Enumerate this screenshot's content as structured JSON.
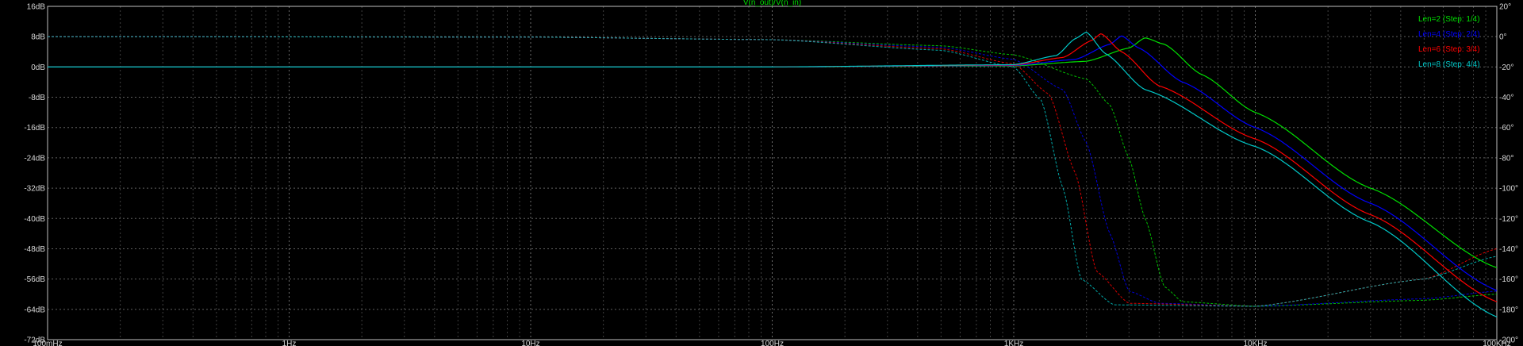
{
  "chart_data": {
    "type": "line",
    "title": "V(n_out)/V(n_in)",
    "x_scale": "log",
    "xlim": [
      0.1,
      100000
    ],
    "ylim_left": [
      -72,
      16
    ],
    "ylim_right": [
      -200,
      20
    ],
    "x_ticks": [
      {
        "value": 0.1,
        "label": "100mHz"
      },
      {
        "value": 1,
        "label": "1Hz"
      },
      {
        "value": 10,
        "label": "10Hz"
      },
      {
        "value": 100,
        "label": "100Hz"
      },
      {
        "value": 1000,
        "label": "1KHz"
      },
      {
        "value": 10000,
        "label": "10KHz"
      },
      {
        "value": 100000,
        "label": "100KHz"
      }
    ],
    "y_left_ticks": [
      {
        "value": 16,
        "label": "16dB"
      },
      {
        "value": 8,
        "label": "8dB"
      },
      {
        "value": 0,
        "label": "0dB"
      },
      {
        "value": -8,
        "label": "-8dB"
      },
      {
        "value": -16,
        "label": "-16dB"
      },
      {
        "value": -24,
        "label": "-24dB"
      },
      {
        "value": -32,
        "label": "-32dB"
      },
      {
        "value": -40,
        "label": "-40dB"
      },
      {
        "value": -48,
        "label": "-48dB"
      },
      {
        "value": -56,
        "label": "-56dB"
      },
      {
        "value": -64,
        "label": "-64dB"
      },
      {
        "value": -72,
        "label": "-72dB"
      }
    ],
    "y_right_ticks": [
      {
        "value": 20,
        "label": "20°"
      },
      {
        "value": 0,
        "label": "0°"
      },
      {
        "value": -20,
        "label": "-20°"
      },
      {
        "value": -40,
        "label": "-40°"
      },
      {
        "value": -60,
        "label": "-60°"
      },
      {
        "value": -80,
        "label": "-80°"
      },
      {
        "value": -100,
        "label": "-100°"
      },
      {
        "value": -120,
        "label": "-120°"
      },
      {
        "value": -140,
        "label": "-140°"
      },
      {
        "value": -160,
        "label": "-160°"
      },
      {
        "value": -180,
        "label": "-180°"
      },
      {
        "value": -200,
        "label": "-200°"
      }
    ],
    "grid": true,
    "legend_position": "top-right",
    "series": [
      {
        "name": "Len=2  (Step: 1/4)",
        "color": "#00e000",
        "magnitude": {
          "x": [
            0.1,
            100,
            1000,
            2000,
            3000,
            3500,
            4200,
            6000,
            10000,
            30000,
            100000
          ],
          "y": [
            0,
            0,
            0.3,
            1.5,
            5.0,
            7.7,
            6.0,
            -2.0,
            -12.0,
            -32.0,
            -53.0
          ]
        },
        "phase": {
          "x": [
            0.1,
            10,
            100,
            500,
            1000,
            2000,
            2500,
            3000,
            3500,
            4200,
            5000,
            10000,
            50000,
            100000
          ],
          "y": [
            0,
            -0.3,
            -2,
            -6,
            -12,
            -28,
            -45,
            -80,
            -120,
            -165,
            -175,
            -178,
            -174,
            -170
          ]
        }
      },
      {
        "name": "Len=4  (Step: 2/4)",
        "color": "#0000ff",
        "magnitude": {
          "x": [
            0.1,
            100,
            1000,
            1800,
            2500,
            2800,
            3300,
            5000,
            10000,
            30000,
            100000
          ],
          "y": [
            0,
            0,
            0.4,
            2.0,
            6.0,
            8.2,
            5.0,
            -4.0,
            -16.0,
            -36.0,
            -59.0
          ]
        },
        "phase": {
          "x": [
            0.1,
            10,
            100,
            500,
            1000,
            1600,
            2000,
            2500,
            3000,
            4000,
            10000,
            50000,
            100000
          ],
          "y": [
            0,
            -0.3,
            -2,
            -7,
            -15,
            -35,
            -70,
            -130,
            -168,
            -176,
            -178,
            -173,
            -168
          ]
        }
      },
      {
        "name": "Len=6  (Step: 3/4)",
        "color": "#ff0000",
        "magnitude": {
          "x": [
            0.1,
            100,
            1000,
            1600,
            2100,
            2300,
            2800,
            4000,
            10000,
            30000,
            100000
          ],
          "y": [
            0,
            0,
            0.5,
            2.5,
            7.0,
            8.8,
            4.0,
            -5.0,
            -19.0,
            -39.0,
            -62.0
          ]
        },
        "phase": {
          "x": [
            0.1,
            10,
            100,
            500,
            1000,
            1400,
            1800,
            2200,
            3000,
            10000,
            50000,
            100000
          ],
          "y": [
            0,
            -0.3,
            -2,
            -8,
            -18,
            -38,
            -90,
            -155,
            -176,
            -178,
            -160,
            -140
          ]
        }
      },
      {
        "name": "Len=8  (Step: 4/4)",
        "color": "#00c8c8",
        "magnitude": {
          "x": [
            0.1,
            100,
            1000,
            1500,
            1800,
            2000,
            2400,
            3500,
            10000,
            30000,
            100000
          ],
          "y": [
            0,
            0,
            0.6,
            3.0,
            7.5,
            9.2,
            3.5,
            -6.0,
            -21.0,
            -41.0,
            -66.0
          ]
        },
        "phase": {
          "x": [
            0.1,
            10,
            100,
            500,
            1000,
            1300,
            1600,
            1900,
            2600,
            10000,
            50000,
            100000
          ],
          "y": [
            0,
            -0.3,
            -2,
            -9,
            -20,
            -42,
            -100,
            -160,
            -177,
            -178,
            -160,
            -145
          ]
        }
      }
    ]
  }
}
